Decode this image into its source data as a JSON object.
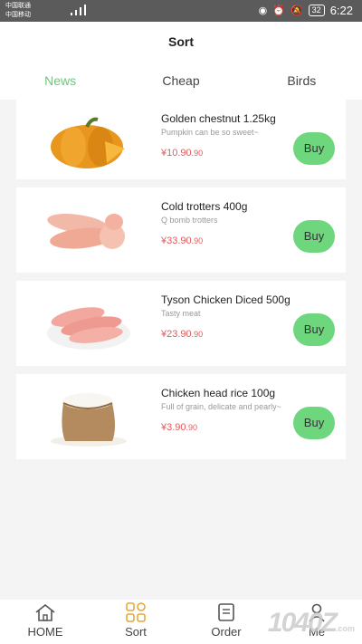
{
  "status_bar": {
    "carrier_1": "中国联通",
    "carrier_2": "中国移动",
    "battery": "32",
    "time": "6:22"
  },
  "header": {
    "title": "Sort"
  },
  "tabs": [
    {
      "label": "News",
      "active": true
    },
    {
      "label": "Cheap",
      "active": false
    },
    {
      "label": "Birds",
      "active": false
    }
  ],
  "products": [
    {
      "name": "Golden chestnut 1.25kg",
      "desc": "Pumpkin can be so sweet~",
      "price": "¥10.90",
      "price_small": ".90",
      "buy": "Buy"
    },
    {
      "name": "Cold trotters 400g",
      "desc": "Q bomb trotters",
      "price": "¥33.90",
      "price_small": ".90",
      "buy": "Buy"
    },
    {
      "name": "Tyson Chicken Diced 500g",
      "desc": "Tasty meat",
      "price": "¥23.90",
      "price_small": ".90",
      "buy": "Buy"
    },
    {
      "name": "Chicken head rice 100g",
      "desc": "Full of grain, delicate and pearly~",
      "price": "¥3.90",
      "price_small": ".90",
      "buy": "Buy"
    }
  ],
  "bottom_nav": [
    {
      "label": "HOME",
      "icon": "home-icon"
    },
    {
      "label": "Sort",
      "icon": "grid-icon"
    },
    {
      "label": "Order",
      "icon": "order-icon"
    },
    {
      "label": "Me",
      "icon": "user-icon"
    }
  ],
  "watermark": {
    "text": "1040Z",
    "sub": ".com"
  },
  "colors": {
    "accent": "#6bc77b",
    "buy_button": "#6ed67d",
    "price": "#e25a5a"
  }
}
